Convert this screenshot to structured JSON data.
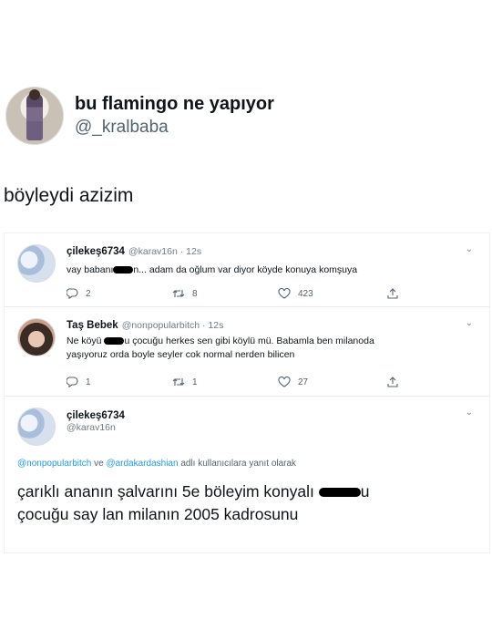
{
  "post": {
    "display_name": "bu flamingo ne yapıyor",
    "handle": "@_kralbaba",
    "text": "böyleydi azizim"
  },
  "screenshot": {
    "tweets": [
      {
        "name": "çilekeş6734",
        "handle_time": "@karav16n · 12s",
        "text_a": "vay babanı",
        "text_b": "n... adam da oğlum var diyor köyde konuya komşuya",
        "replies": "2",
        "retweets": "8",
        "likes": "423"
      },
      {
        "name": "Taş Bebek",
        "handle_time": "@nonpopularbitch · 12s",
        "line1_a": "Ne köyü",
        "line1_b": "u çocuğu herkes sen gibi köylü mü. Babamla ben milanoda",
        "line2": "yaşıyoruz orda boyle seyler cok normal nerden bilicen",
        "replies": "1",
        "retweets": "1",
        "likes": "27"
      }
    ],
    "main": {
      "name": "çilekeş6734",
      "handle": "@karav16n",
      "reply_mention1": "@nonpopularbitch",
      "reply_ve": " ve ",
      "reply_mention2": "@ardakardashian",
      "reply_rest": " adlı kullanıcılara yanıt olarak",
      "line1_a": "çarıklı ananın şalvarını 5e böleyim konyalı",
      "line1_b": "u",
      "line2": "çocuğu say lan milanın 2005 kadrosunu"
    }
  },
  "icons": {
    "chevron": "chevron-down-icon",
    "reply": "reply-icon",
    "retweet": "retweet-icon",
    "like": "heart-icon",
    "share": "share-icon"
  },
  "colors": {
    "link": "#1d9bf0",
    "secondary": "#536471"
  }
}
